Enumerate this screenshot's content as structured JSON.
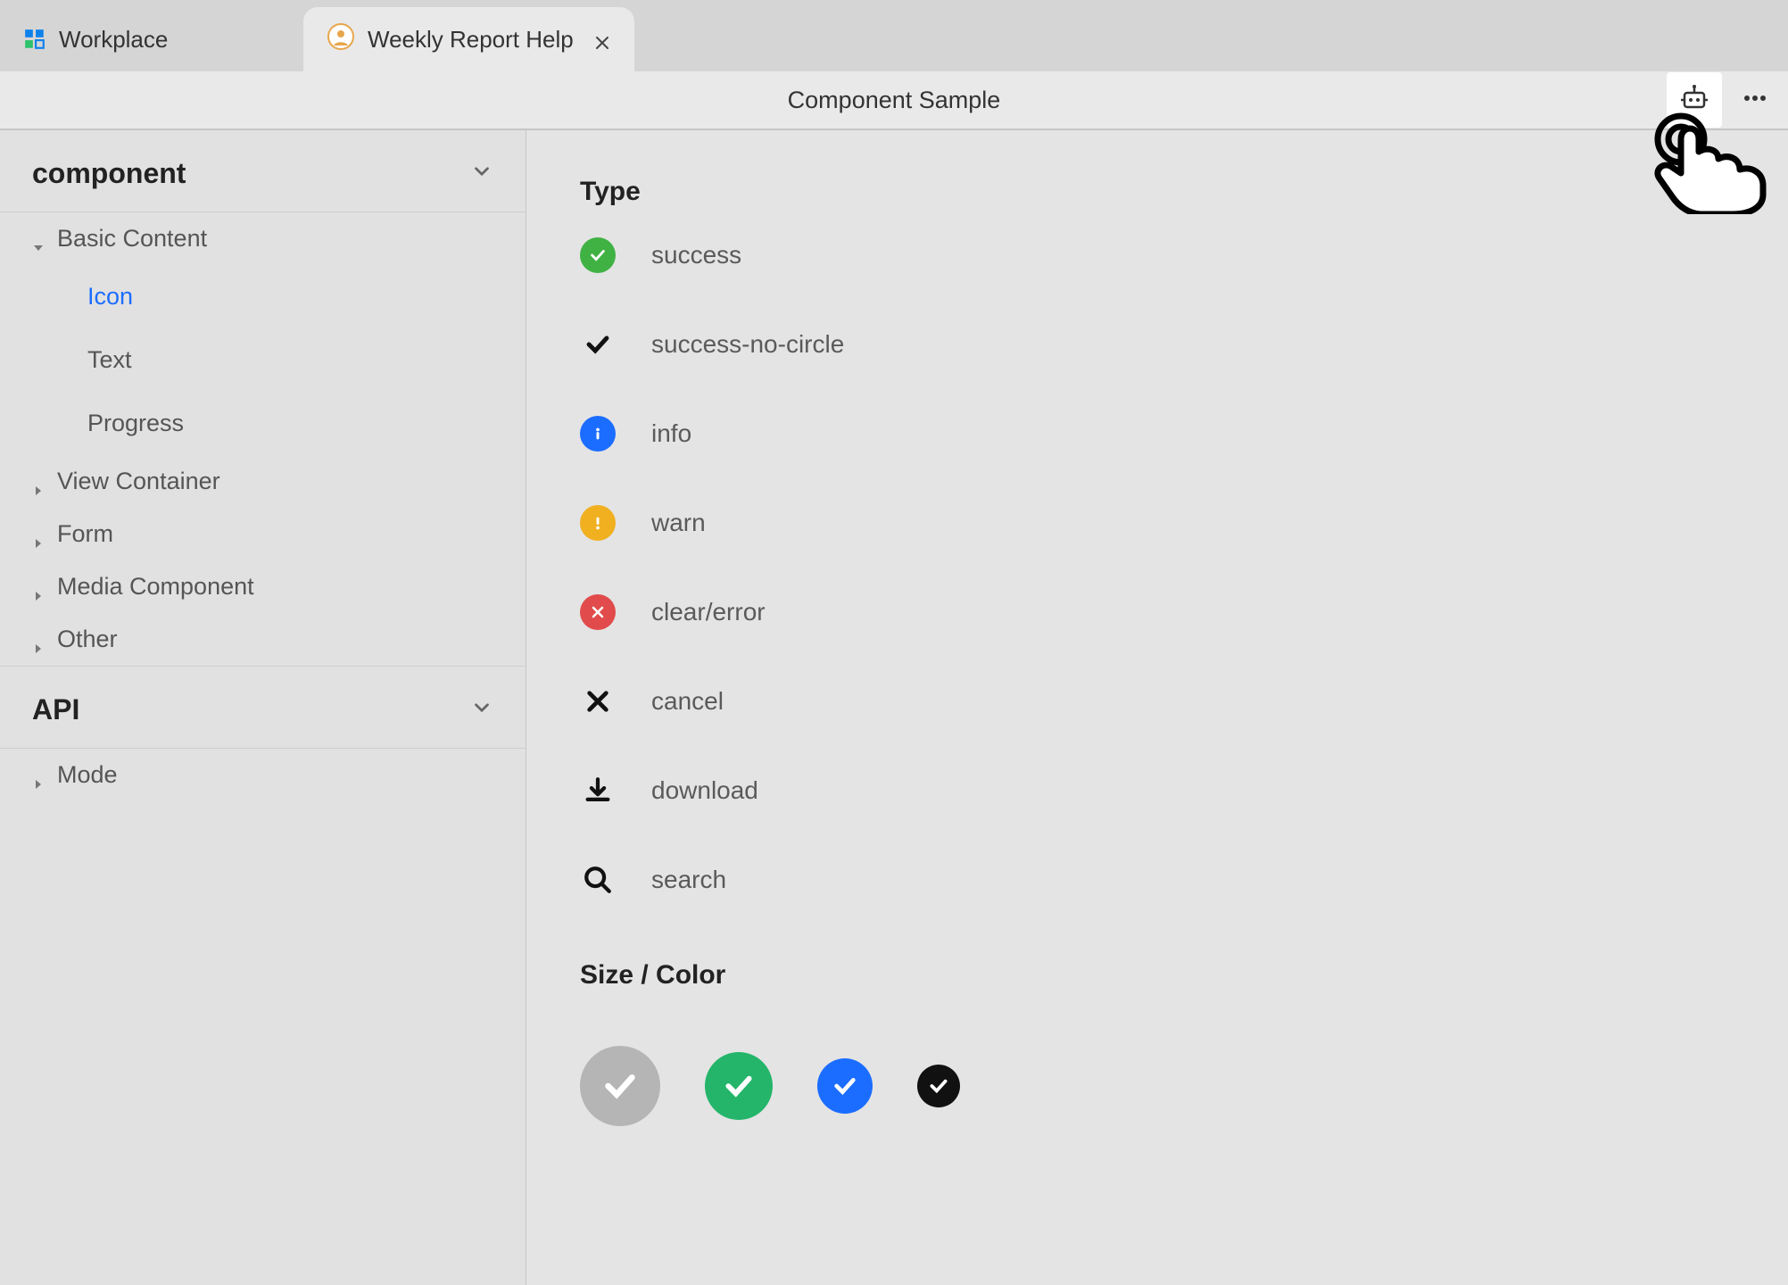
{
  "tabs": {
    "workplace": "Workplace",
    "active": "Weekly Report Help"
  },
  "toolbar": {
    "title": "Component Sample"
  },
  "sidebar": {
    "section1": "component",
    "groups": {
      "basic": "Basic Content",
      "view": "View Container",
      "form": "Form",
      "media": "Media Component",
      "other": "Other"
    },
    "basic_children": {
      "icon": "Icon",
      "text": "Text",
      "progress": "Progress"
    },
    "section2": "API",
    "api_children": {
      "mode": "Mode"
    }
  },
  "content": {
    "type_heading": "Type",
    "types": {
      "success": "success",
      "success_no_circle": "success-no-circle",
      "info": "info",
      "warn": "warn",
      "clear_error": "clear/error",
      "cancel": "cancel",
      "download": "download",
      "search": "search"
    },
    "size_heading": "Size / Color"
  },
  "colors": {
    "success": "#40b244",
    "info": "#1b6dff",
    "warn": "#f0b020",
    "error": "#e14b4b"
  }
}
